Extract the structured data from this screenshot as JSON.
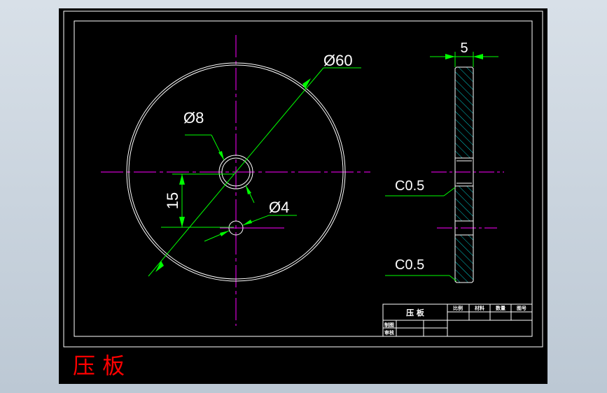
{
  "drawing": {
    "title_label": "压 板",
    "dimensions": {
      "outer_diameter": "Ø60",
      "center_hole": "Ø8",
      "small_hole": "Ø4",
      "hole_offset": "15",
      "thickness": "5",
      "chamfer_upper": "C0.5",
      "chamfer_lower": "C0.5"
    },
    "title_block": {
      "part_name": "压 板",
      "headers": [
        "比例",
        "材料",
        "数量",
        "图号"
      ],
      "row_drawn": "制图",
      "row_checked": "审核"
    }
  },
  "colors": {
    "background": "#000000",
    "outline": "#ffffff",
    "dimension": "#00ff00",
    "centerline": "#ff00ff",
    "hatch": "#00cccc",
    "title": "#ff0000"
  }
}
